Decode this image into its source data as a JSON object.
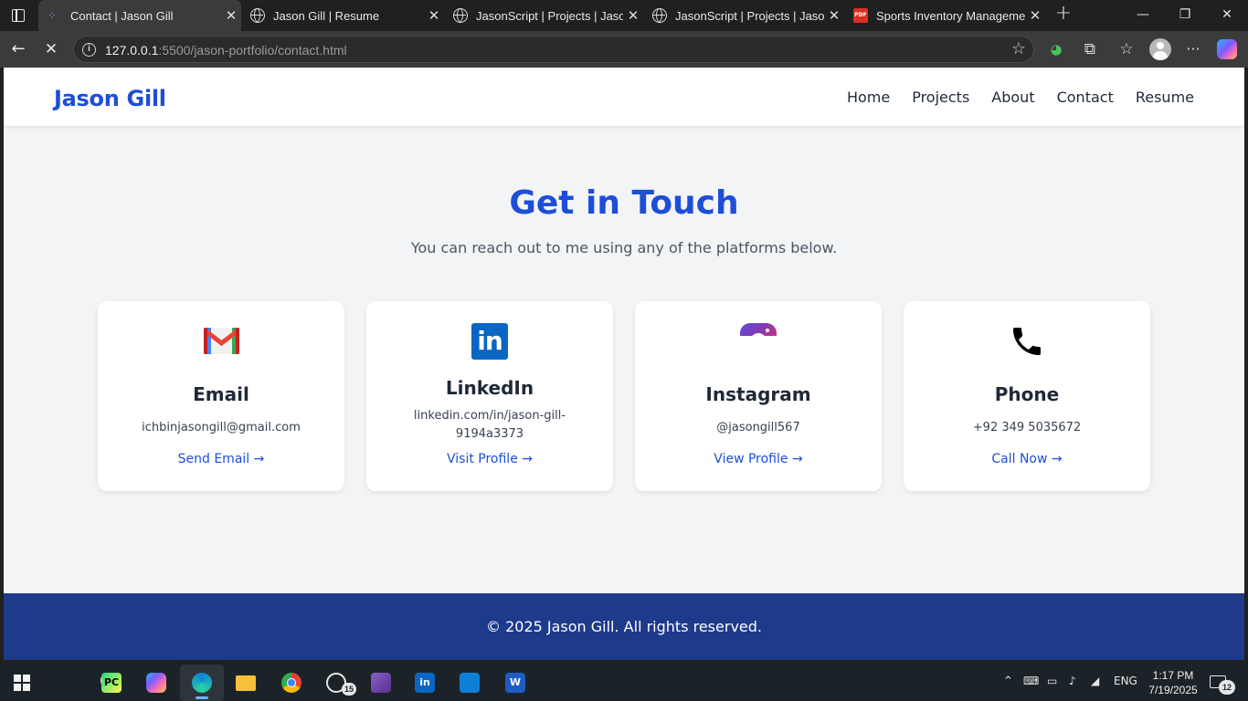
{
  "browser": {
    "tabs": [
      {
        "title": "Contact | Jason Gill",
        "active": true,
        "favicon": "loading-spinner-icon"
      },
      {
        "title": "Jason Gill | Resume",
        "active": false,
        "favicon": "globe-icon"
      },
      {
        "title": "JasonScript | Projects | Jason G",
        "active": false,
        "favicon": "globe-icon"
      },
      {
        "title": "JasonScript | Projects | Jason G",
        "active": false,
        "favicon": "globe-icon"
      },
      {
        "title": "Sports Inventory Managemen",
        "active": false,
        "favicon": "pdf-icon"
      }
    ],
    "address": {
      "host": "127.0.0.1",
      "rest": ":5500/jason-portfolio/contact.html"
    },
    "accent_color": "#1d4ed8"
  },
  "page": {
    "brand": "Jason Gill",
    "nav": [
      "Home",
      "Projects",
      "About",
      "Contact",
      "Resume"
    ],
    "hero": {
      "title": "Get in Touch",
      "subtitle": "You can reach out to me using any of the platforms below."
    },
    "cards": [
      {
        "icon": "gmail-icon",
        "title": "Email",
        "detail": "ichbinjasongill@gmail.com",
        "link": "Send Email →"
      },
      {
        "icon": "linkedin-icon",
        "title": "LinkedIn",
        "detail": "linkedin.com/in/jason-gill-9194a3373",
        "link": "Visit Profile →"
      },
      {
        "icon": "instagram-icon",
        "title": "Instagram",
        "detail": "@jasongill567",
        "link": "View Profile →"
      },
      {
        "icon": "phone-icon",
        "title": "Phone",
        "detail": "+92 349 5035672",
        "link": "Call Now →"
      }
    ],
    "footer": "© 2025 Jason Gill. All rights reserved.",
    "colors": {
      "footer_bg": "#1e3a8a",
      "page_bg": "#f3f4f6"
    }
  },
  "taskbar": {
    "apps": [
      {
        "name": "pycharm-icon"
      },
      {
        "name": "copilot-app-icon"
      },
      {
        "name": "edge-icon",
        "active": true
      },
      {
        "name": "file-explorer-icon"
      },
      {
        "name": "chrome-icon"
      },
      {
        "name": "whatsapp-icon",
        "badge": "15"
      },
      {
        "name": "visual-studio-icon"
      },
      {
        "name": "linkedin-app-icon",
        "label": "in"
      },
      {
        "name": "vscode-icon"
      },
      {
        "name": "word-icon",
        "label": "W"
      }
    ],
    "tray": {
      "language": "ENG",
      "time": "1:17 PM",
      "date": "7/19/2025",
      "notifications": "12"
    }
  }
}
